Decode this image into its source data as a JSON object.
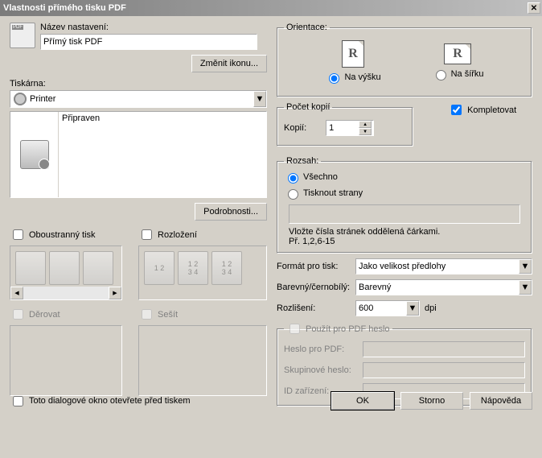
{
  "title": "Vlastnosti přímého tisku PDF",
  "close_glyph": "✕",
  "left": {
    "name_label": "Název nastavení:",
    "name_value": "Přímý tisk PDF",
    "change_icon_btn": "Změnit ikonu...",
    "printer_label": "Tiskárna:",
    "printer_selected": "Printer",
    "printer_status": "Připraven",
    "details_btn": "Podrobnosti...",
    "duplex_label": "Oboustranný tisk",
    "layout_label": "Rozložení",
    "punch_label": "Děrovat",
    "staple_label": "Sešít"
  },
  "orientation": {
    "legend": "Orientace:",
    "glyph": "R",
    "portrait": "Na výšku",
    "landscape": "Na šířku"
  },
  "copies": {
    "legend": "Počet kopií",
    "label": "Kopií:",
    "value": "1",
    "collate": "Kompletovat"
  },
  "range": {
    "legend": "Rozsah:",
    "all": "Všechno",
    "pages": "Tisknout strany",
    "hint1": "Vložte čísla stránek oddělená čárkami.",
    "hint2": "Př. 1,2,6-15"
  },
  "format": {
    "label": "Formát pro tisk:",
    "value": "Jako velikost předlohy"
  },
  "color": {
    "label": "Barevný/černobílý:",
    "value": "Barevný"
  },
  "resolution": {
    "label": "Rozlišení:",
    "value": "600",
    "unit": "dpi"
  },
  "pdf_pw": {
    "legend": "Použít pro PDF heslo",
    "pdf_label": "Heslo pro PDF:",
    "group_label": "Skupinové heslo:",
    "device_label": "ID zařízení:"
  },
  "footer": {
    "open_before": "Toto dialogové okno otevřete před tiskem",
    "ok": "OK",
    "cancel": "Storno",
    "help": "Nápověda"
  },
  "arrow_down": "▼",
  "arrow_up": "▲",
  "arrow_left": "◀",
  "arrow_right": "▶"
}
